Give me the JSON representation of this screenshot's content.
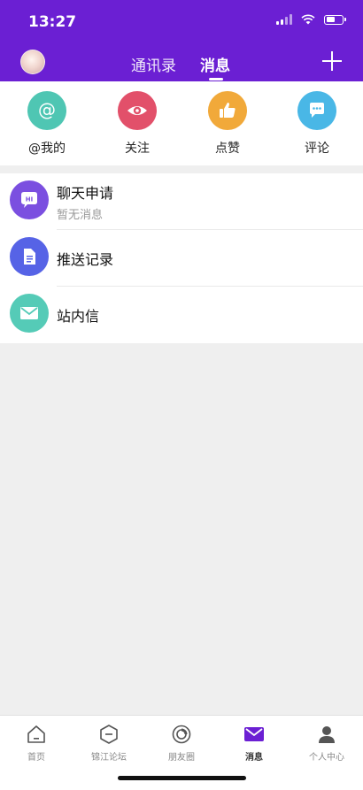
{
  "status_bar": {
    "time": "13:27"
  },
  "nav": {
    "tabs": [
      {
        "label": "通讯录"
      },
      {
        "label": "消息"
      }
    ]
  },
  "quick_actions": [
    {
      "label": "@我的",
      "icon": "at-icon",
      "color": "#4FC6B3"
    },
    {
      "label": "关注",
      "icon": "eye-icon",
      "color": "#E2506A"
    },
    {
      "label": "点赞",
      "icon": "thumbs-up-icon",
      "color": "#F1A93A"
    },
    {
      "label": "评论",
      "icon": "comment-icon",
      "color": "#49B7E6"
    }
  ],
  "list": [
    {
      "title": "聊天申请",
      "subtitle": "暂无消息",
      "icon": "hi-chat-icon",
      "color": "#7B4FE0"
    },
    {
      "title": "推送记录",
      "icon": "document-icon",
      "color": "#5663E6"
    },
    {
      "title": "站内信",
      "icon": "envelope-icon",
      "color": "#55CBB7"
    }
  ],
  "tabbar": [
    {
      "label": "首页",
      "icon": "home-icon"
    },
    {
      "label": "锦江论坛",
      "icon": "forum-icon"
    },
    {
      "label": "朋友圈",
      "icon": "moments-icon"
    },
    {
      "label": "消息",
      "icon": "envelope-icon",
      "active": true
    },
    {
      "label": "个人中心",
      "icon": "person-icon"
    }
  ],
  "colors": {
    "primary": "#6B1FD3"
  }
}
